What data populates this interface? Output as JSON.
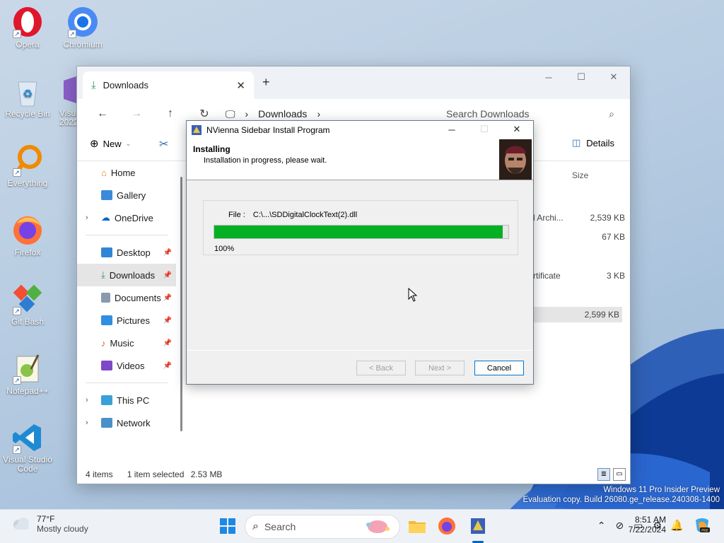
{
  "desktop": {
    "icons": [
      {
        "label": "Opera"
      },
      {
        "label": "Chromium"
      },
      {
        "label": "Recycle Bin"
      },
      {
        "label": "Visua 2022"
      },
      {
        "label": "Everything"
      },
      {
        "label": "Firefox"
      },
      {
        "label": "Git Bash"
      },
      {
        "label": "Notepad++"
      },
      {
        "label": "Visual Studio Code"
      }
    ]
  },
  "explorer": {
    "tab_title": "Downloads",
    "address": {
      "segment": "Downloads"
    },
    "search_placeholder": "Search Downloads",
    "toolbar": {
      "new_label": "New",
      "details_label": "Details"
    },
    "column_size": "Size",
    "nav": [
      {
        "label": "Home"
      },
      {
        "label": "Gallery"
      },
      {
        "label": "OneDrive"
      },
      {
        "label": "Desktop"
      },
      {
        "label": "Downloads"
      },
      {
        "label": "Documents"
      },
      {
        "label": "Pictures"
      },
      {
        "label": "Music"
      },
      {
        "label": "Videos"
      },
      {
        "label": "This PC"
      },
      {
        "label": "Network"
      }
    ],
    "files": [
      {
        "type": "l Archi...",
        "size": "2,539 KB"
      },
      {
        "type": "",
        "size": "67 KB"
      },
      {
        "type": "rtificate",
        "size": "3 KB"
      },
      {
        "type": "",
        "size": "2,599 KB"
      }
    ],
    "status": {
      "items": "4 items",
      "selected": "1 item selected",
      "size": "2.53 MB"
    }
  },
  "installer": {
    "title": "NVienna Sidebar Install Program",
    "heading": "Installing",
    "subheading": "Installation in progress, please wait.",
    "file_label": "File :",
    "file_path": "C:\\...\\SDDigitalClockText(2).dll",
    "progress": 0.98,
    "percent_text": "100%",
    "buttons": {
      "back": "< Back",
      "next": "Next >",
      "cancel": "Cancel"
    }
  },
  "taskbar": {
    "weather_temp": "77°F",
    "weather_desc": "Mostly cloudy",
    "search_label": "Search",
    "time": "8:51 AM",
    "date": "7/22/2024"
  },
  "watermark": {
    "line1": "Windows 11 Pro Insider Preview",
    "line2": "Evaluation copy. Build 26080.ge_release.240308-1400"
  },
  "colors": {
    "progress_fill": "#06b025",
    "accent": "#0078d4"
  }
}
